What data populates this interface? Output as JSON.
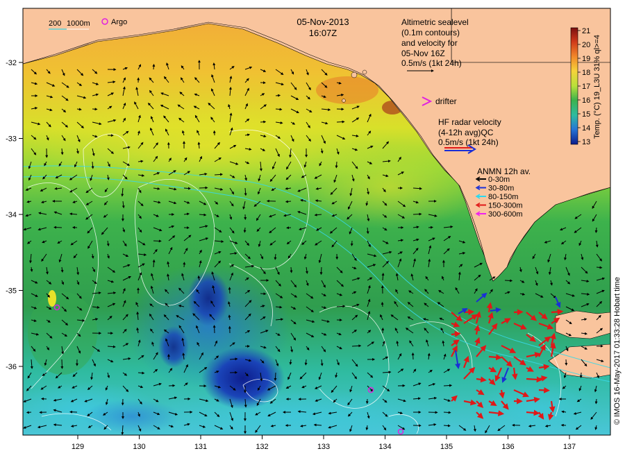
{
  "title": {
    "date": "05-Nov-2013",
    "time": "16:07Z"
  },
  "scale_bar": {
    "d1": "200",
    "d2": "1000m"
  },
  "argo_label": "Argo",
  "altimetry_legend": [
    "Altimetric sealevel",
    "(0.1m contours)",
    "and velocity for",
    "05-Nov 16Z",
    "0.5m/s (1kt 24h)"
  ],
  "drifter_label": "drifter",
  "hf_radar_legend": [
    "HF radar velocity",
    "(4-12h avg)QC",
    "0.5m/s (1kt 24h)"
  ],
  "anmn_legend": {
    "title": "ANMN 12h av.",
    "items": [
      {
        "label": "0-30m",
        "color": "#000000"
      },
      {
        "label": "30-80m",
        "color": "#1a2fd6"
      },
      {
        "label": "80-150m",
        "color": "#28d9f0"
      },
      {
        "label": "150-300m",
        "color": "#e01818"
      },
      {
        "label": "300-600m",
        "color": "#f020f0"
      }
    ]
  },
  "colorbar": {
    "ticks": [
      "21",
      "20",
      "19",
      "18",
      "17",
      "16",
      "15",
      "14",
      "13"
    ],
    "label": "Temp. (°C) 19_L3U 31% ql>=4"
  },
  "credit": "© IMOS 16-May-2017 01:33:28 Hobart time",
  "axes": {
    "x_ticks": [
      "129",
      "130",
      "131",
      "132",
      "133",
      "134",
      "135",
      "136",
      "137"
    ],
    "y_ticks": [
      "-32",
      "-33",
      "-34",
      "-35",
      "-36"
    ]
  },
  "colors": {
    "land": "#f9c49d",
    "sea_warm": "#f2a93a",
    "sea_cool": "#2f9d4e",
    "sea_cold": "#0d1d8c"
  }
}
